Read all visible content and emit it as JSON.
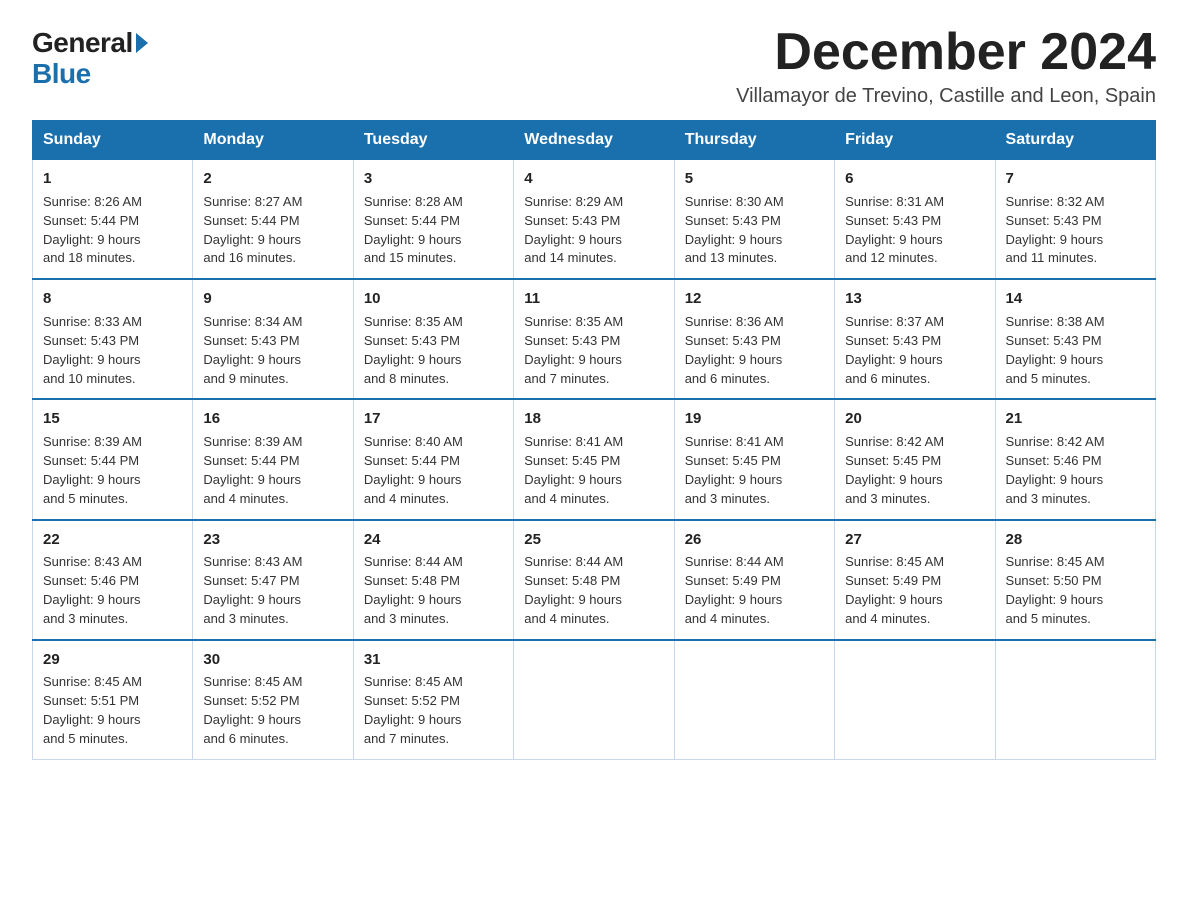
{
  "logo": {
    "general": "General",
    "blue": "Blue"
  },
  "title": "December 2024",
  "subtitle": "Villamayor de Trevino, Castille and Leon, Spain",
  "days_of_week": [
    "Sunday",
    "Monday",
    "Tuesday",
    "Wednesday",
    "Thursday",
    "Friday",
    "Saturday"
  ],
  "weeks": [
    [
      {
        "date": "1",
        "sunrise": "8:26 AM",
        "sunset": "5:44 PM",
        "daylight": "9 hours and 18 minutes."
      },
      {
        "date": "2",
        "sunrise": "8:27 AM",
        "sunset": "5:44 PM",
        "daylight": "9 hours and 16 minutes."
      },
      {
        "date": "3",
        "sunrise": "8:28 AM",
        "sunset": "5:44 PM",
        "daylight": "9 hours and 15 minutes."
      },
      {
        "date": "4",
        "sunrise": "8:29 AM",
        "sunset": "5:43 PM",
        "daylight": "9 hours and 14 minutes."
      },
      {
        "date": "5",
        "sunrise": "8:30 AM",
        "sunset": "5:43 PM",
        "daylight": "9 hours and 13 minutes."
      },
      {
        "date": "6",
        "sunrise": "8:31 AM",
        "sunset": "5:43 PM",
        "daylight": "9 hours and 12 minutes."
      },
      {
        "date": "7",
        "sunrise": "8:32 AM",
        "sunset": "5:43 PM",
        "daylight": "9 hours and 11 minutes."
      }
    ],
    [
      {
        "date": "8",
        "sunrise": "8:33 AM",
        "sunset": "5:43 PM",
        "daylight": "9 hours and 10 minutes."
      },
      {
        "date": "9",
        "sunrise": "8:34 AM",
        "sunset": "5:43 PM",
        "daylight": "9 hours and 9 minutes."
      },
      {
        "date": "10",
        "sunrise": "8:35 AM",
        "sunset": "5:43 PM",
        "daylight": "9 hours and 8 minutes."
      },
      {
        "date": "11",
        "sunrise": "8:35 AM",
        "sunset": "5:43 PM",
        "daylight": "9 hours and 7 minutes."
      },
      {
        "date": "12",
        "sunrise": "8:36 AM",
        "sunset": "5:43 PM",
        "daylight": "9 hours and 6 minutes."
      },
      {
        "date": "13",
        "sunrise": "8:37 AM",
        "sunset": "5:43 PM",
        "daylight": "9 hours and 6 minutes."
      },
      {
        "date": "14",
        "sunrise": "8:38 AM",
        "sunset": "5:43 PM",
        "daylight": "9 hours and 5 minutes."
      }
    ],
    [
      {
        "date": "15",
        "sunrise": "8:39 AM",
        "sunset": "5:44 PM",
        "daylight": "9 hours and 5 minutes."
      },
      {
        "date": "16",
        "sunrise": "8:39 AM",
        "sunset": "5:44 PM",
        "daylight": "9 hours and 4 minutes."
      },
      {
        "date": "17",
        "sunrise": "8:40 AM",
        "sunset": "5:44 PM",
        "daylight": "9 hours and 4 minutes."
      },
      {
        "date": "18",
        "sunrise": "8:41 AM",
        "sunset": "5:45 PM",
        "daylight": "9 hours and 4 minutes."
      },
      {
        "date": "19",
        "sunrise": "8:41 AM",
        "sunset": "5:45 PM",
        "daylight": "9 hours and 3 minutes."
      },
      {
        "date": "20",
        "sunrise": "8:42 AM",
        "sunset": "5:45 PM",
        "daylight": "9 hours and 3 minutes."
      },
      {
        "date": "21",
        "sunrise": "8:42 AM",
        "sunset": "5:46 PM",
        "daylight": "9 hours and 3 minutes."
      }
    ],
    [
      {
        "date": "22",
        "sunrise": "8:43 AM",
        "sunset": "5:46 PM",
        "daylight": "9 hours and 3 minutes."
      },
      {
        "date": "23",
        "sunrise": "8:43 AM",
        "sunset": "5:47 PM",
        "daylight": "9 hours and 3 minutes."
      },
      {
        "date": "24",
        "sunrise": "8:44 AM",
        "sunset": "5:48 PM",
        "daylight": "9 hours and 3 minutes."
      },
      {
        "date": "25",
        "sunrise": "8:44 AM",
        "sunset": "5:48 PM",
        "daylight": "9 hours and 4 minutes."
      },
      {
        "date": "26",
        "sunrise": "8:44 AM",
        "sunset": "5:49 PM",
        "daylight": "9 hours and 4 minutes."
      },
      {
        "date": "27",
        "sunrise": "8:45 AM",
        "sunset": "5:49 PM",
        "daylight": "9 hours and 4 minutes."
      },
      {
        "date": "28",
        "sunrise": "8:45 AM",
        "sunset": "5:50 PM",
        "daylight": "9 hours and 5 minutes."
      }
    ],
    [
      {
        "date": "29",
        "sunrise": "8:45 AM",
        "sunset": "5:51 PM",
        "daylight": "9 hours and 5 minutes."
      },
      {
        "date": "30",
        "sunrise": "8:45 AM",
        "sunset": "5:52 PM",
        "daylight": "9 hours and 6 minutes."
      },
      {
        "date": "31",
        "sunrise": "8:45 AM",
        "sunset": "5:52 PM",
        "daylight": "9 hours and 7 minutes."
      },
      null,
      null,
      null,
      null
    ]
  ],
  "labels": {
    "sunrise": "Sunrise:",
    "sunset": "Sunset:",
    "daylight": "Daylight:"
  }
}
